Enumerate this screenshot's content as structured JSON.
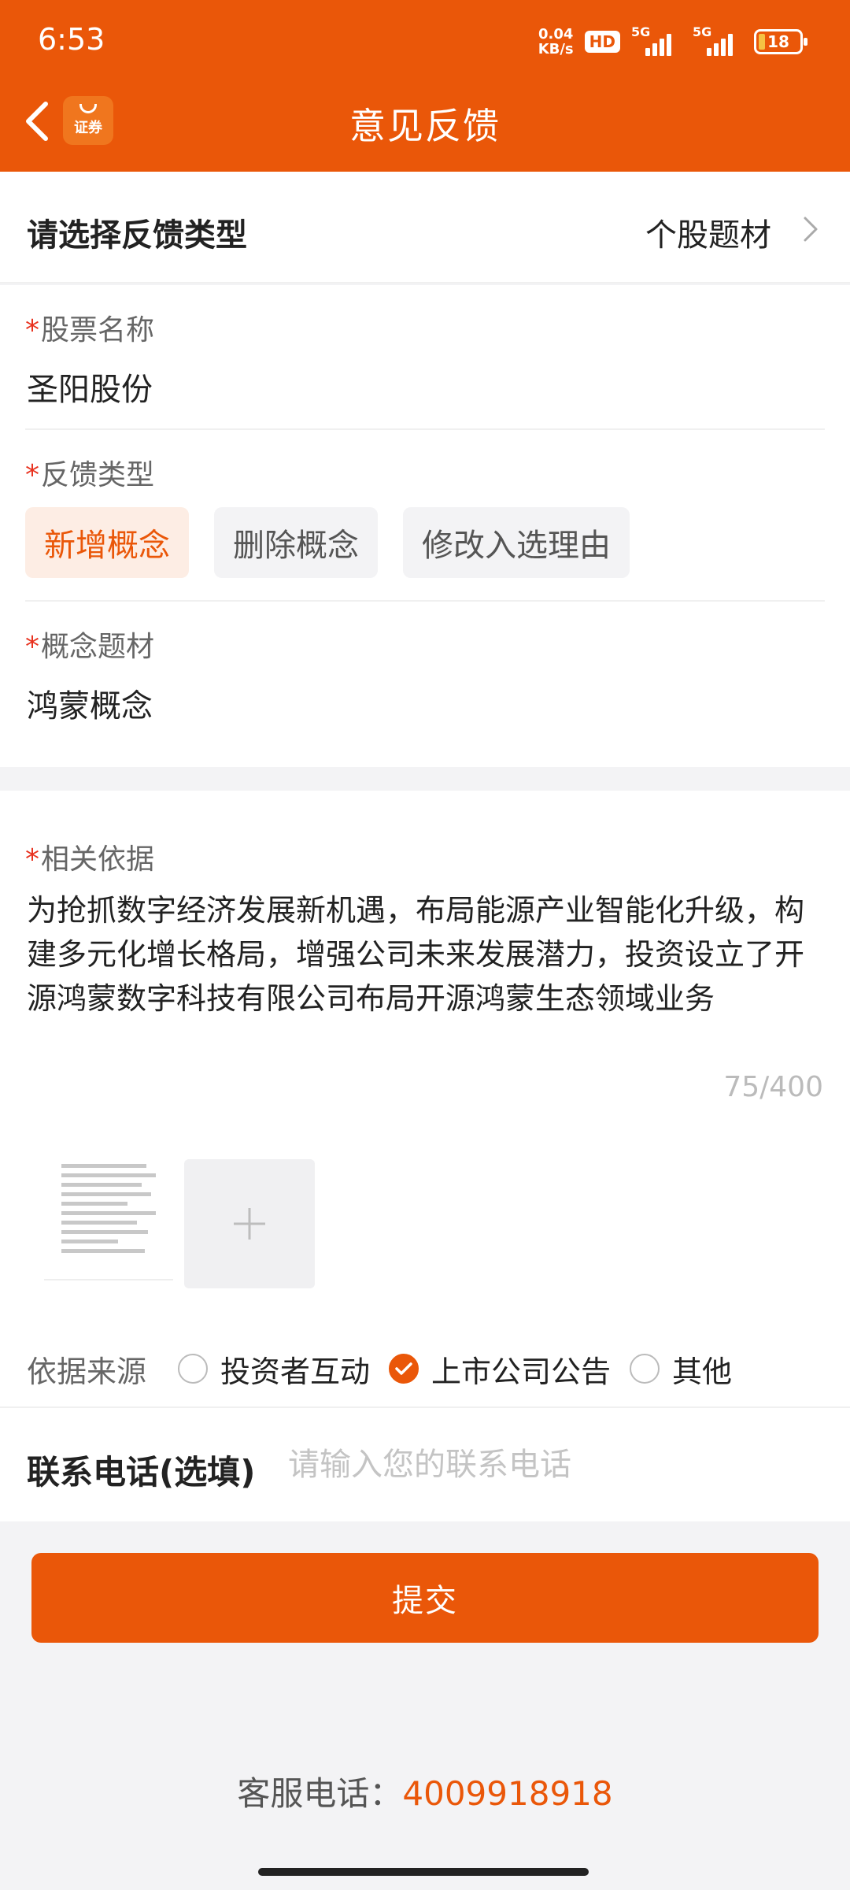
{
  "status_bar": {
    "time": "6:53",
    "net_speed_value": "0.04",
    "net_speed_unit": "KB/s",
    "hd_label": "HD",
    "signal1_label": "5G",
    "signal2_label": "5G",
    "battery_level": "18"
  },
  "header": {
    "title": "意见反馈",
    "logo_text": "证券",
    "colors": {
      "brand": "#EA5709"
    }
  },
  "feedback_category": {
    "label": "请选择反馈类型",
    "value": "个股题材"
  },
  "required_mark": "*",
  "stock_name": {
    "label": "股票名称",
    "value": "圣阳股份"
  },
  "feedback_type": {
    "label": "反馈类型",
    "options": [
      "新增概念",
      "删除概念",
      "修改入选理由"
    ],
    "selected": "新增概念"
  },
  "concept": {
    "label": "概念题材",
    "value": "鸿蒙概念"
  },
  "basis": {
    "label": "相关依据",
    "text": "为抢抓数字经济发展新机遇，布局能源产业智能化升级，构建多元化增长格局，增强公司未来发展潜力，投资设立了开源鸿蒙数字科技有限公司布局开源鸿蒙生态领域业务",
    "counter": "75/400"
  },
  "source": {
    "label": "依据来源",
    "options": [
      "投资者互动",
      "上市公司公告",
      "其他"
    ],
    "selected": "上市公司公告"
  },
  "contact": {
    "label": "联系电话(选填)",
    "placeholder": "请输入您的联系电话",
    "value": ""
  },
  "submit_label": "提交",
  "customer_service": {
    "label": "客服电话：",
    "number": "4009918918"
  }
}
